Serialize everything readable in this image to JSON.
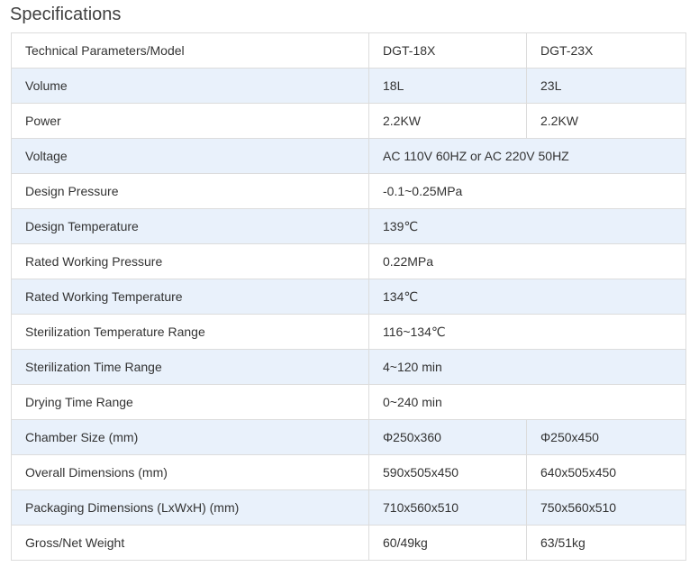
{
  "heading": "Specifications",
  "rows": [
    {
      "label": "Technical Parameters/Model",
      "cells": [
        "DGT-18X",
        "DGT-23X"
      ]
    },
    {
      "label": "Volume",
      "cells": [
        "18L",
        "23L"
      ]
    },
    {
      "label": "Power",
      "cells": [
        "2.2KW",
        "2.2KW"
      ]
    },
    {
      "label": "Voltage",
      "cells": [
        "AC 110V 60HZ or AC 220V 50HZ"
      ]
    },
    {
      "label": "Design Pressure",
      "cells": [
        "-0.1~0.25MPa"
      ]
    },
    {
      "label": "Design Temperature",
      "cells": [
        "139℃"
      ]
    },
    {
      "label": "Rated Working Pressure",
      "cells": [
        "0.22MPa"
      ]
    },
    {
      "label": "Rated Working Temperature",
      "cells": [
        "134℃"
      ]
    },
    {
      "label": "Sterilization Temperature Range",
      "cells": [
        "116~134℃"
      ]
    },
    {
      "label": "Sterilization Time Range",
      "cells": [
        "4~120 min"
      ]
    },
    {
      "label": "Drying Time Range",
      "cells": [
        "0~240 min"
      ]
    },
    {
      "label": "Chamber Size (mm)",
      "cells": [
        "Φ250x360",
        "Φ250x450"
      ]
    },
    {
      "label": "Overall Dimensions (mm)",
      "cells": [
        "590x505x450",
        "640x505x450"
      ]
    },
    {
      "label": "Packaging Dimensions (LxWxH) (mm)",
      "cells": [
        "710x560x510",
        "750x560x510"
      ]
    },
    {
      "label": "Gross/Net Weight",
      "cells": [
        "60/49kg",
        "63/51kg"
      ]
    }
  ],
  "colors": {
    "stripe": "#e9f1fb",
    "border": "#dcdcdc",
    "text": "#333333"
  }
}
